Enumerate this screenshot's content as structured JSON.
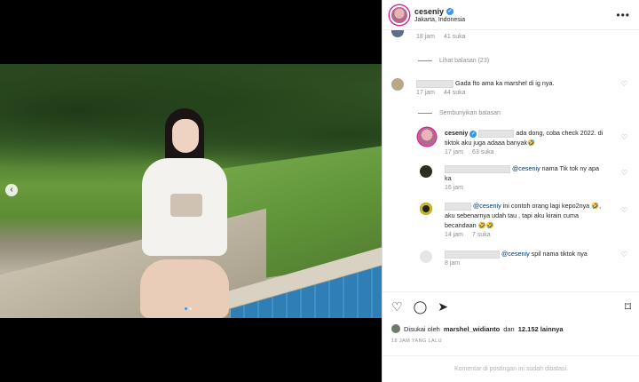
{
  "post": {
    "username": "ceseniy",
    "location": "Jakarta, Indonesia",
    "more_glyph": "•••",
    "carousel_prev_glyph": "‹"
  },
  "comments": {
    "top_meta": {
      "time": "18 jam",
      "likes": "41 suka"
    },
    "view_replies": "Lihat balasan (23)",
    "c1": {
      "text": "Gada fto ama ka marshel di ig nya.",
      "time": "17 jam",
      "likes": "44 suka"
    },
    "hide_replies": "Sembunyikan balasan",
    "r1": {
      "username": "ceseniy",
      "text_a": "ada dong, coba check 2022. di",
      "text_b": "tiktok aku juga adaaa banyak🤣",
      "time": "17 jam",
      "likes": "63 suka"
    },
    "r2": {
      "mention": "@ceseniy",
      "text_a": "nama Tik tok ny apa",
      "text_b": "ka",
      "time": "16 jam"
    },
    "r3": {
      "mention": "@ceseniy",
      "text_a": "ini contoh orang lagi kepo2nya 🤣,",
      "text_b": "aku sebenarnya udah tau , tapi aku kirain cuma",
      "text_c": "becandaan 🤣🤣",
      "time": "14 jam",
      "likes": "7 suka"
    },
    "r4": {
      "mention": "@ceseniy",
      "text_a": "spil nama tiktok nya",
      "time": "8 jam"
    }
  },
  "actions": {
    "liked_by_prefix": "Disukai oleh",
    "liked_by_user": "marshel_widianto",
    "liked_by_conj": "dan",
    "liked_by_count": "12.152 lainnya",
    "timestamp": "18 JAM YANG LALU",
    "comments_disabled": "Komentar di postingan ini sudah dibatasi."
  },
  "icons": {
    "like": "heart-icon",
    "comment": "comment-icon",
    "share": "share-icon",
    "save": "bookmark-icon",
    "verified": "verified-badge-icon"
  },
  "colors": {
    "verified": "#3897f0",
    "muted": "#8e8e8e",
    "mention": "#00376b"
  }
}
